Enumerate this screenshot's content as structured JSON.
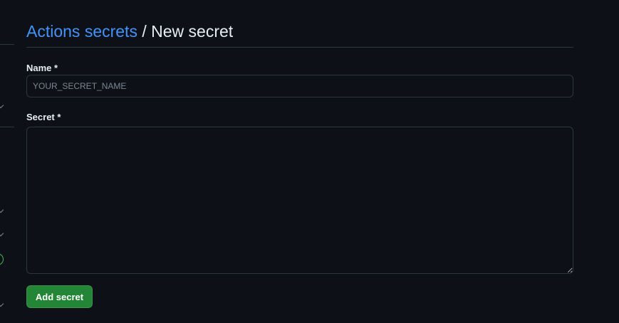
{
  "header": {
    "breadcrumb_link": "Actions secrets",
    "separator": "/",
    "current_page": "New secret"
  },
  "form": {
    "name_label": "Name *",
    "name_value": "",
    "name_placeholder": "YOUR_SECRET_NAME",
    "secret_label": "Secret *",
    "secret_value": "",
    "submit_label": "Add secret"
  },
  "colors": {
    "background": "#0d1117",
    "link": "#4493f8",
    "border": "#30363d",
    "primary_button": "#238636",
    "status_green": "#3fb950"
  },
  "icons": {
    "sidebar_chevrons": [
      "chevron-down-icon",
      "chevron-down-icon",
      "chevron-down-icon",
      "chevron-down-icon"
    ],
    "sidebar_badge": "status-circle-icon"
  }
}
